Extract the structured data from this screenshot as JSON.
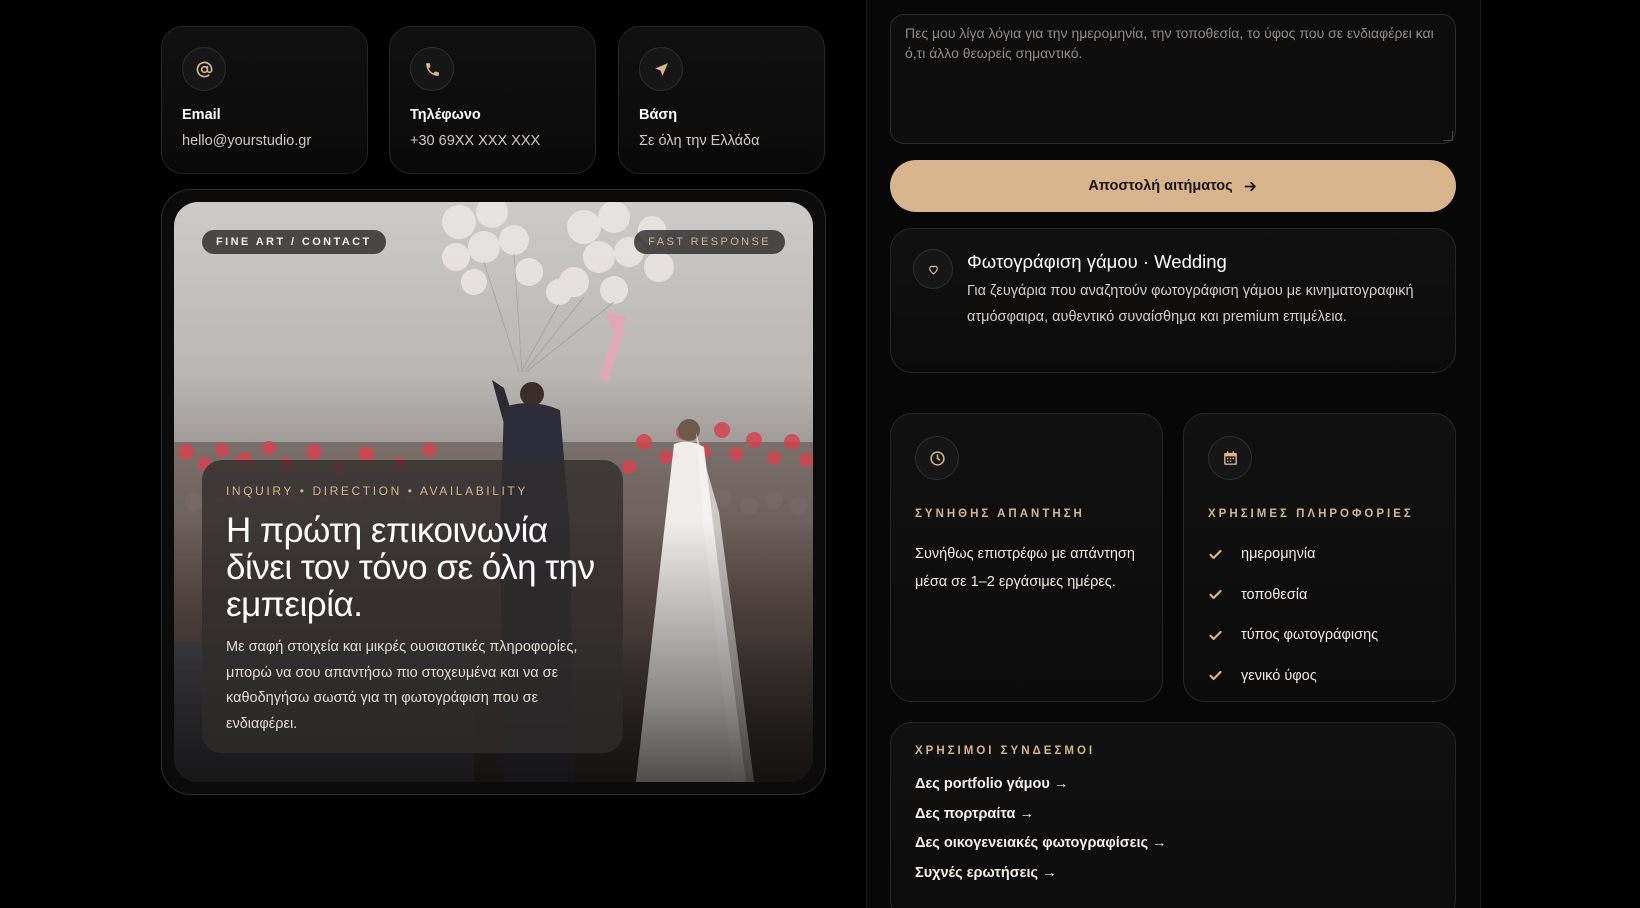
{
  "contacts": [
    {
      "icon": "at-icon",
      "label": "Email",
      "value": "hello@yourstudio.gr"
    },
    {
      "icon": "phone-icon",
      "label": "Τηλέφωνο",
      "value": "+30 69XX XXX XXX"
    },
    {
      "icon": "location-arrow-icon",
      "label": "Βάση",
      "value": "Σε όλη την Ελλάδα"
    }
  ],
  "hero": {
    "badge_left": "FINE ART / CONTACT",
    "badge_right": "FAST RESPONSE",
    "eyebrow": "INQUIRY • DIRECTION • AVAILABILITY",
    "title": "Η πρώτη επικοινωνία δίνει τον τόνο σε όλη την εμπειρία.",
    "text": "Με σαφή στοιχεία και μικρές ουσιαστικές πληροφορίες, μπορώ να σου απαντήσω πιο στοχευμένα και να σε καθοδηγήσω σωστά για τη φωτογράφιση που σε ενδιαφέρει."
  },
  "form": {
    "message_placeholder": "Πες μου λίγα λόγια για την ημερομηνία, την τοποθεσία, το ύφος που σε ενδιαφέρει και ό,τι άλλο θεωρείς σημαντικό.",
    "submit_label": "Αποστολή αιτήματος"
  },
  "service": {
    "icon": "heart-icon",
    "title": "Φωτογράφιση γάμου · Wedding",
    "description": "Για ζευγάρια που αναζητούν φωτογράφιση γάμου με κινηματογραφική ατμόσφαιρα, αυθεντικό συναίσθημα και premium επιμέλεια."
  },
  "response_box": {
    "icon": "clock-icon",
    "heading": "ΣΥΝΗΘΗΣ ΑΠΑΝΤΗΣΗ",
    "text": "Συνήθως επιστρέφω με απάντηση μέσα σε 1–2 εργάσιμες ημέρες."
  },
  "info_box": {
    "icon": "calendar-icon",
    "heading": "ΧΡΗΣΙΜΕΣ ΠΛΗΡΟΦΟΡΙΕΣ",
    "items": [
      "ημερομηνία",
      "τοποθεσία",
      "τύπος φωτογράφισης",
      "γενικό ύφος"
    ]
  },
  "links": {
    "heading": "ΧΡΗΣΙΜΟΙ ΣΥΝΔΕΣΜΟΙ",
    "items": [
      "Δες portfolio γάμου →",
      "Δες πορτραίτα →",
      "Δες οικογενειακές φωτογραφίσεις →",
      "Συχνές ερωτήσεις →"
    ]
  },
  "colors": {
    "accent": "#d7b48c",
    "background": "#000000",
    "card": "#0f0f0f",
    "border": "#262626"
  }
}
